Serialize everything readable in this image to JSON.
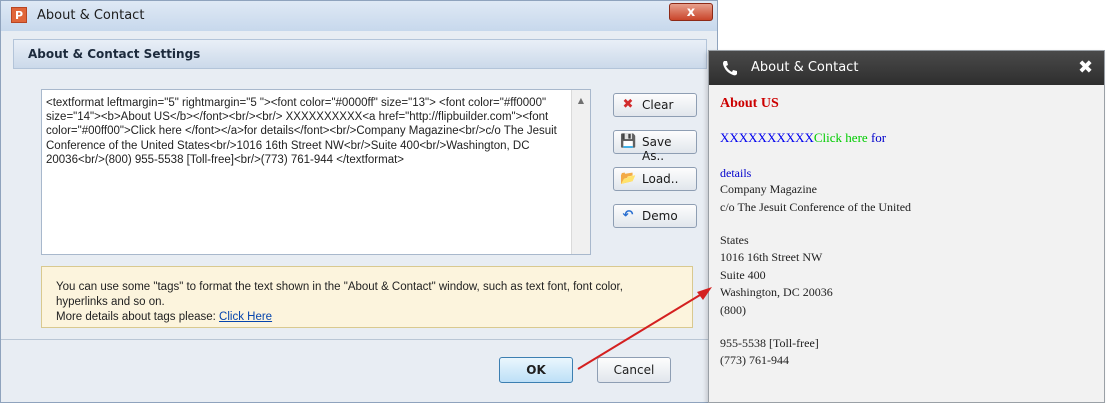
{
  "window": {
    "title": "About & Contact",
    "app_icon_letter": "P",
    "close_label": "x"
  },
  "settings": {
    "header": "About & Contact Settings"
  },
  "editor": {
    "text": "<textformat leftmargin=\"5\" rightmargin=\"5 \"><font color=\"#0000ff\" size=\"13\"> <font color=\"#ff0000\" size=\"14\"><b>About US</b></font><br/><br/> XXXXXXXXXX<a href=\"http://flipbuilder.com\"><font color=\"#00ff00\">Click here </font></a>for details</font><br/>Company Magazine<br/>c/o The Jesuit Conference of the United States<br/>1016 16th Street NW<br/>Suite 400<br/>Washington, DC 20036<br/>(800) 955-5538 [Toll-free]<br/>(773) 761-944 </textformat>",
    "scroll_up": "▲"
  },
  "buttons": {
    "clear": "Clear",
    "save_as": "Save As..",
    "load": "Load..",
    "demo": "Demo",
    "ok": "OK",
    "cancel": "Cancel"
  },
  "icons": {
    "clear": "✖",
    "save_as": "💾",
    "load": "📂",
    "demo": "↶"
  },
  "info": {
    "line1": "You can use some \"tags\" to format the text shown in the \"About & Contact\" window, such as text font, font color,",
    "line2": "hyperlinks and so on.",
    "line3_prefix": "More details about tags please:",
    "link": "Click Here"
  },
  "preview": {
    "title": "About & Contact",
    "close": "✖",
    "heading": "About US",
    "x_text": "XXXXXXXXXX",
    "click_here": "Click here",
    "for_text": " for",
    "details": "details",
    "lines": [
      "Company Magazine",
      "c/o The Jesuit Conference of the United",
      "States",
      "1016 16th Street NW",
      "Suite 400",
      "Washington, DC 20036",
      "(800)",
      "955-5538 [Toll-free]",
      "(773) 761-944"
    ]
  },
  "colors": {
    "heading_red": "#cc0000",
    "link_blue": "#0000ee",
    "click_green": "#00cc00",
    "arrow_red": "#d42020"
  }
}
